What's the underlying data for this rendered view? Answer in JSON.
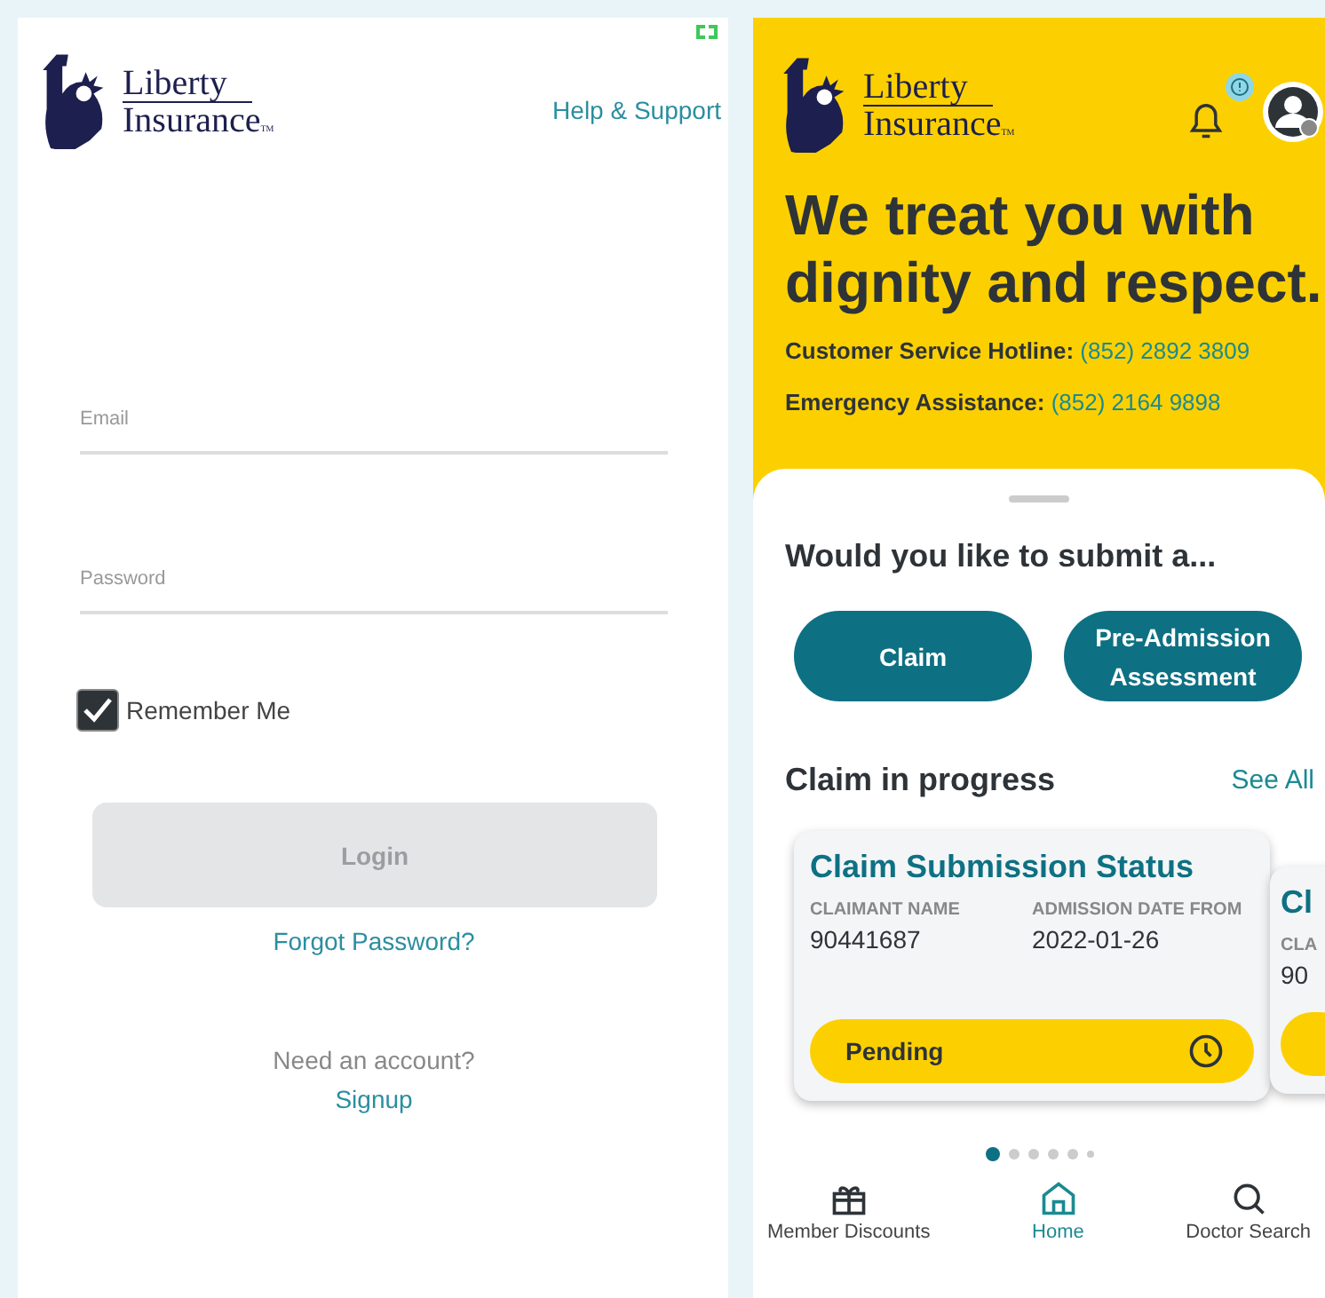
{
  "login_screen": {
    "logo": {
      "line_1": "Liberty",
      "line_2": "Insurance",
      "mark": "TM"
    },
    "help_link": "Help & Support",
    "fields": [
      {
        "placeholder": "Email"
      },
      {
        "placeholder": "Password"
      }
    ],
    "remember_me": {
      "label": "Remember Me",
      "checked": true
    },
    "login_button": {
      "label": "Login",
      "disabled": true
    },
    "forgot_password": "Forgot Password?",
    "signup_prompt": "Need an account?",
    "signup_link": "Signup"
  },
  "home_screen": {
    "logo": {
      "line_1": "Liberty",
      "line_2": "Insurance",
      "mark": "TM"
    },
    "headline": "We treat you with dignity and respect.",
    "contacts": [
      {
        "label": "Customer Service Hotline:",
        "number": "(852) 2892 3809"
      },
      {
        "label": "Emergency Assistance:",
        "number": "(852) 2164 9898"
      }
    ],
    "submit_title": "Would you like to submit a...",
    "submit_buttons": [
      "Claim",
      "Pre-Admission Assessment"
    ],
    "progress_title": "Claim in progress",
    "see_all": "See All",
    "cards": [
      {
        "title": "Claim Submission Status",
        "fields": [
          {
            "label": "CLAIMANT NAME",
            "value": "90441687"
          },
          {
            "label": "ADMISSION DATE FROM",
            "value": "2022-01-26"
          }
        ],
        "status": "Pending"
      },
      {
        "title": "Cl",
        "fields": [
          {
            "label": "CLA",
            "value": "90"
          }
        ]
      }
    ],
    "pager": [
      {
        "selected": true
      },
      {
        "selected": false
      },
      {
        "selected": false
      },
      {
        "selected": false
      },
      {
        "selected": false
      },
      {
        "selected": false
      }
    ],
    "nav": [
      {
        "label": "Member Discounts",
        "kind": "gift",
        "selected": false
      },
      {
        "label": "Home",
        "kind": "home",
        "selected": true
      },
      {
        "label": "Doctor Search",
        "kind": "search",
        "selected": false
      }
    ]
  }
}
